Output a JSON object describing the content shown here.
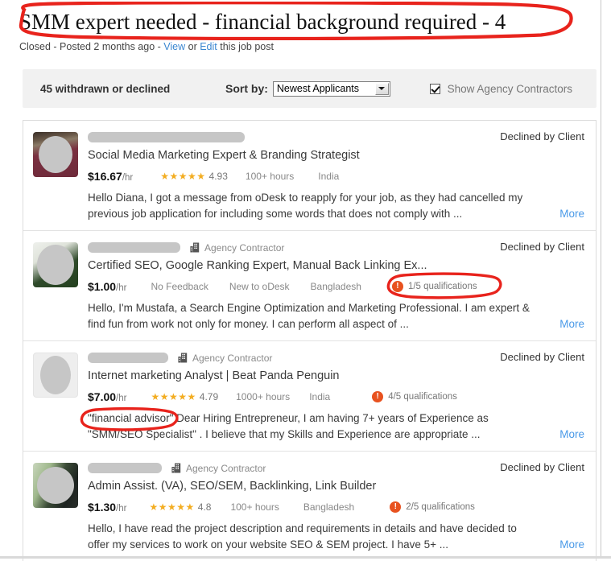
{
  "header": {
    "job_title": "SMM expert needed - financial background required - 4",
    "status": "Closed",
    "separator1": " - ",
    "posted": "Posted 2 months ago",
    "separator2": " - ",
    "view_link": "View",
    "or_text": " or ",
    "edit_link": "Edit",
    "trailing_text": " this job post"
  },
  "toolbar": {
    "count_label": "45 withdrawn or declined",
    "sort_label": "Sort by:",
    "sort_value": "Newest Applicants",
    "sort_options": [
      "Newest Applicants"
    ],
    "show_agency_label": "Show Agency Contractors",
    "show_agency_checked": true
  },
  "annotations": {
    "color": "#e8231c",
    "title_circle": "hand-drawn red ellipse around job title",
    "qualification_circle": "hand-drawn red ellipse around 1/5 qualifications",
    "phrase_circle": "hand-drawn red ellipse around financial advisor"
  },
  "applicants": [
    {
      "name_redacted": true,
      "redaction_width": 195,
      "is_agency": false,
      "agency_label": "",
      "status": "Declined by Client",
      "headline": "Social Media Marketing Expert & Branding Strategist",
      "rate": "$16.67",
      "rate_unit": "/hr",
      "stars": "★★★★★",
      "score": "4.93",
      "hours": "100+ hours",
      "country": "India",
      "qualifications": "",
      "cover_letter": "Hello Diana, I got a message from oDesk to reapply for your job, as they had cancelled my previous job application for including some words that does not comply with ...",
      "more_label": "More",
      "avatar_style": "photo-maroon"
    },
    {
      "name_redacted": true,
      "redaction_width": 115,
      "is_agency": true,
      "agency_label": "Agency Contractor",
      "status": "Declined by Client",
      "headline": "Certified SEO, Google Ranking Expert, Manual Back Linking Ex...",
      "rate": "$1.00",
      "rate_unit": "/hr",
      "stars": "",
      "score": "",
      "feedback": "No Feedback",
      "hours": "New to oDesk",
      "country": "Bangladesh",
      "qualifications": "1/5 qualifications",
      "cover_letter": "Hello, I'm Mustafa, a Search Engine Optimization and Marketing Professional. I am expert & find fun from work not only for money. I can perform all aspect of ...",
      "more_label": "More",
      "avatar_style": "photo-green"
    },
    {
      "name_redacted": true,
      "redaction_width": 100,
      "is_agency": true,
      "agency_label": "Agency Contractor",
      "status": "Declined by Client",
      "headline": "Internet marketing Analyst | Beat Panda Penguin",
      "rate": "$7.00",
      "rate_unit": "/hr",
      "stars": "★★★★★",
      "score": "4.79",
      "hours": "1000+ hours",
      "country": "India",
      "qualifications": "4/5 qualifications",
      "cover_letter_highlight": "\"financial advisor\"",
      "cover_letter": " Dear Hiring Entrepreneur, I am having 7+ years of Experience as \"SMM/SEO Specialist\" . I believe that my Skills and Experience are appropriate ...",
      "more_label": "More",
      "avatar_style": "placeholder"
    },
    {
      "name_redacted": true,
      "redaction_width": 92,
      "is_agency": true,
      "agency_label": "Agency Contractor",
      "status": "Declined by Client",
      "headline": "Admin Assist. (VA), SEO/SEM, Backlinking, Link Builder",
      "rate": "$1.30",
      "rate_unit": "/hr",
      "stars": "★★★★★",
      "score": "4.8",
      "hours": "100+ hours",
      "country": "Bangladesh",
      "qualifications": "2/5 qualifications",
      "cover_letter": "Hello, I have read the project description and requirements in details and have decided to offer my services to work on your website SEO & SEM project. I have 5+ ...",
      "more_label": "More",
      "avatar_style": "photo-dark-green"
    }
  ]
}
